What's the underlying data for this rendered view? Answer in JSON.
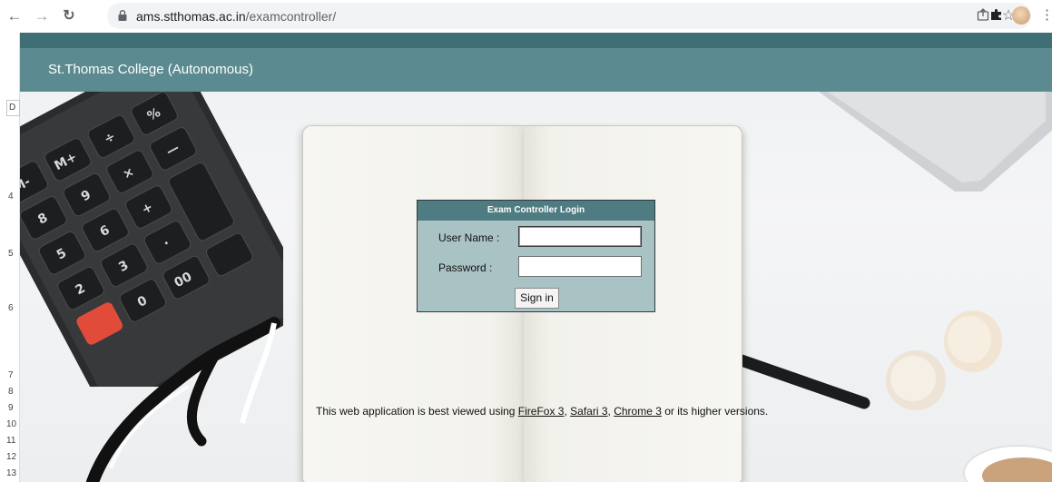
{
  "browser": {
    "back_icon": "arrow-left-icon",
    "forward_icon": "arrow-right-icon",
    "reload_icon": "reload-icon",
    "url_host": "ams.stthomas.ac.in",
    "url_path": "/examcontroller/",
    "share_icon": "share-icon",
    "bookmark_icon": "star-icon",
    "extensions_icon": "puzzle-icon",
    "menu_icon": "kebab-menu-icon"
  },
  "spreadsheet_sliver": {
    "cell_label": "D",
    "row_numbers": [
      "4",
      "5",
      "6",
      "7",
      "8",
      "9",
      "10",
      "11",
      "12",
      "13"
    ]
  },
  "site": {
    "title": "St.Thomas College (Autonomous)"
  },
  "login": {
    "heading": "Exam Controller Login",
    "username_label": "User Name :",
    "username_value": "",
    "password_label": "Password :",
    "password_value": "",
    "signin_label": "Sign in"
  },
  "footer": {
    "text_before": "This web application is best viewed using ",
    "firefox_link": "FireFox 3",
    "sep1": ", ",
    "safari_link": "Safari 3",
    "sep2": ", ",
    "chrome_link": "Chrome 3",
    "text_after": " or its higher versions."
  },
  "colors": {
    "top_strip": "#3f6e74",
    "banner": "#5b8b90",
    "login_header": "#4e7c82",
    "login_body": "#a9c2c4"
  }
}
